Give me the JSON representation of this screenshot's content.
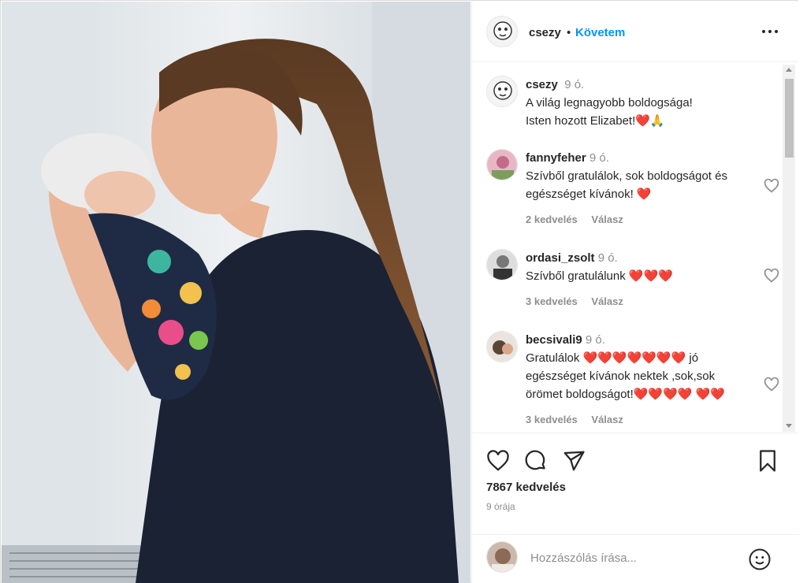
{
  "post": {
    "username": "csezy",
    "dot": "•",
    "follow_label": "Követem",
    "more_icon": "more-options-icon"
  },
  "caption": {
    "username": "csezy",
    "time": "9 ó.",
    "line1": "A világ legnagyobb boldogsága!",
    "line2": "Isten hozott Elizabet!",
    "emojis": "❤️🙏"
  },
  "comments": [
    {
      "username": "fannyfeher",
      "time": "9 ó.",
      "text": "Szívből gratulálok, sok boldogságot és egészséget kívánok! ❤️",
      "likes": "2 kedvelés",
      "reply": "Válasz"
    },
    {
      "username": "ordasi_zsolt",
      "time": "9 ó.",
      "text": "Szívből gratulálunk ❤️❤️❤️",
      "likes": "3 kedvelés",
      "reply": "Válasz"
    },
    {
      "username": "becsivali9",
      "time": "9 ó.",
      "text": "Gratulálok ❤️❤️❤️❤️❤️❤️❤️ jó egészséget kívánok nektek ,sok,sok örömet boldogságot!❤️❤️❤️❤️ ❤️❤️",
      "likes": "3 kedvelés",
      "reply": "Válasz"
    }
  ],
  "stats": {
    "likes": "7867 kedvelés",
    "time": "9 órája"
  },
  "add_comment": {
    "placeholder": "Hozzászólás írása..."
  },
  "colors": {
    "accent": "#0095f6",
    "heart": "#e00c2f"
  }
}
